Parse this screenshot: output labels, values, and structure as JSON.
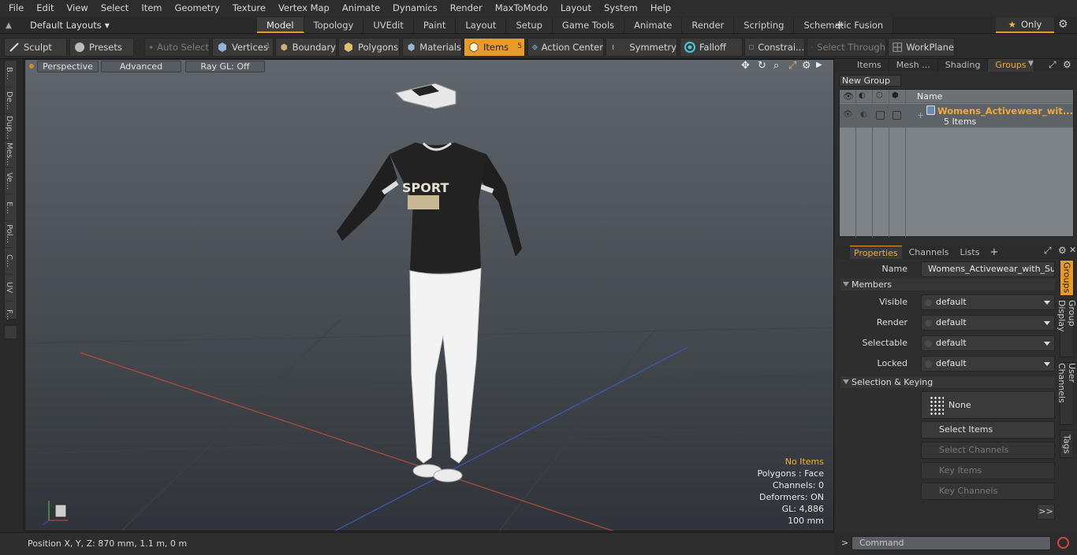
{
  "menubar": [
    "File",
    "Edit",
    "View",
    "Select",
    "Item",
    "Geometry",
    "Texture",
    "Vertex Map",
    "Animate",
    "Dynamics",
    "Render",
    "MaxToModo",
    "Layout",
    "System",
    "Help"
  ],
  "layouts": {
    "label": "Default Layouts"
  },
  "tabs": [
    "Model",
    "Topology",
    "UVEdit",
    "Paint",
    "Layout",
    "Setup",
    "Game Tools",
    "Animate",
    "Render",
    "Scripting",
    "Schematic Fusion"
  ],
  "only_label": "Only",
  "toolbar": {
    "sculpt": "Sculpt",
    "presets": "Presets",
    "auto_select": "Auto Select",
    "vertices": "Vertices",
    "vertices_count": "1",
    "boundary": "Boundary",
    "polygons": "Polygons",
    "materials": "Materials",
    "items": "Items",
    "items_count": "5",
    "action_center": "Action Center",
    "symmetry": "Symmetry",
    "falloff": "Falloff",
    "constraints": "Constrai...",
    "select_through": "Select Through",
    "workplane": "WorkPlane"
  },
  "left_sidebar": [
    "B...",
    "De...",
    "Dup...",
    "Mes...",
    "Ve...",
    "E...",
    "Pol...",
    "C...",
    "UV",
    "F..."
  ],
  "viewport": {
    "perspective": "Perspective",
    "advanced": "Advanced",
    "raygl": "Ray GL: Off",
    "stats": {
      "no_items": "No Items",
      "polygons": "Polygons : Face",
      "channels": "Channels: 0",
      "deformers": "Deformers: ON",
      "gl": "GL: 4,886",
      "scale": "100 mm"
    },
    "shirt_text": "SPORT"
  },
  "status": {
    "position": "Position X, Y, Z:  870 mm, 1.1 m, 0 m"
  },
  "right_panel": {
    "tabs": [
      "Items",
      "Mesh ...",
      "Shading",
      "Groups"
    ],
    "new_group": "New Group",
    "name_col": "Name",
    "group_name": "Womens_Activewear_wit...",
    "group_count": "5 Items"
  },
  "properties": {
    "tabs": [
      "Properties",
      "Channels",
      "Lists"
    ],
    "side_tabs": [
      "Groups",
      "Group Display",
      "User Channels",
      "Tags"
    ],
    "name_label": "Name",
    "name_value": "Womens_Activewear_with_Sun_",
    "members": "Members",
    "visible": {
      "label": "Visible",
      "value": "default"
    },
    "render": {
      "label": "Render",
      "value": "default"
    },
    "selectable": {
      "label": "Selectable",
      "value": "default"
    },
    "locked": {
      "label": "Locked",
      "value": "default"
    },
    "selection_keying": "Selection & Keying",
    "none": "None",
    "select_items": "Select Items",
    "select_channels": "Select Channels",
    "key_items": "Key Items",
    "key_channels": "Key Channels",
    "more": ">>"
  },
  "command": {
    "placeholder": "Command"
  }
}
